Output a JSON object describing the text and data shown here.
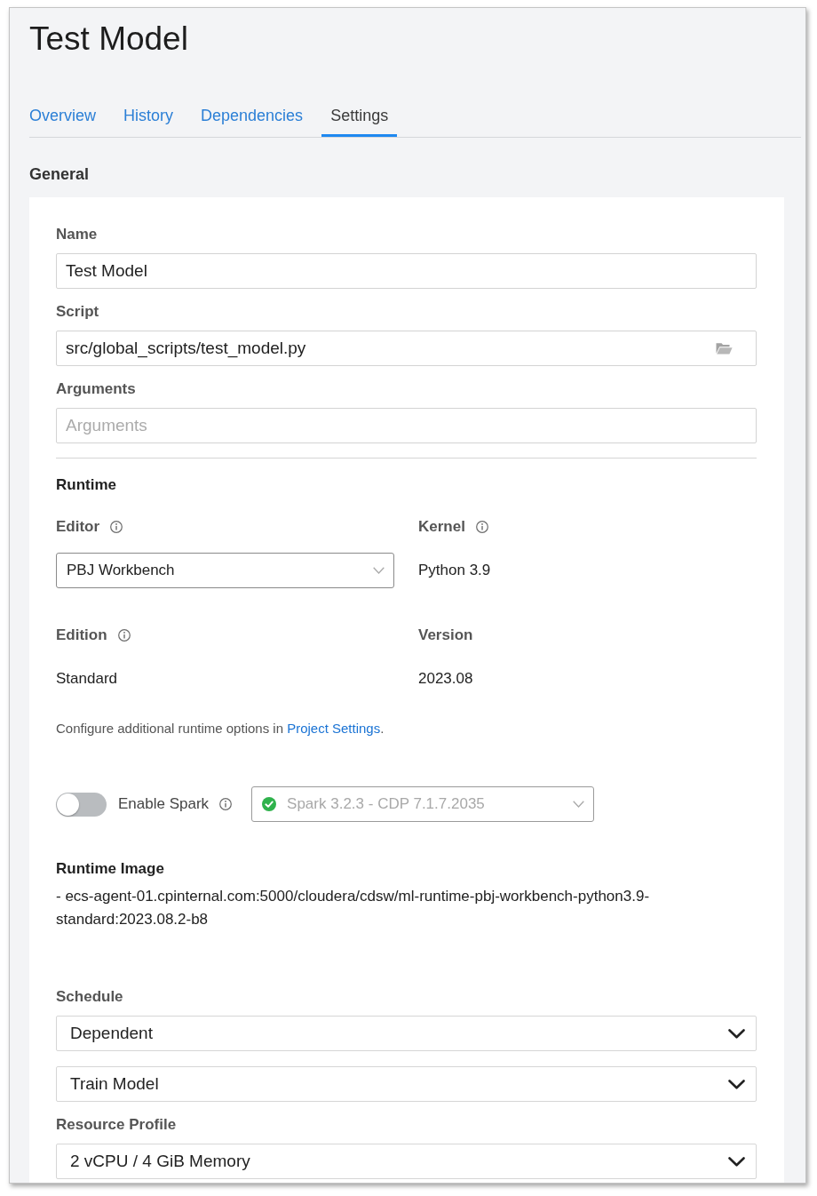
{
  "page": {
    "title": "Test Model"
  },
  "tabs": [
    {
      "label": "Overview",
      "selected": false
    },
    {
      "label": "History",
      "selected": false
    },
    {
      "label": "Dependencies",
      "selected": false
    },
    {
      "label": "Settings",
      "selected": true
    }
  ],
  "general": {
    "heading": "General",
    "fields": [
      {
        "kind": "text",
        "label": "Name",
        "value": "Test Model"
      },
      {
        "kind": "file",
        "label": "Script",
        "value": "src/global_scripts/test_model.py"
      },
      {
        "kind": "text",
        "label": "Arguments",
        "placeholder": "Arguments"
      }
    ]
  },
  "runtime": {
    "heading": "Runtime",
    "fields": [
      {
        "kind": "select",
        "label": "Editor",
        "info": true,
        "value": "PBJ Workbench"
      },
      {
        "kind": "static",
        "label": "Kernel",
        "info": true,
        "value": "Python 3.9"
      },
      {
        "kind": "static",
        "label": "Edition",
        "info": true,
        "value": "Standard"
      },
      {
        "kind": "static",
        "label": "Version",
        "info": false,
        "value": "2023.08"
      }
    ],
    "note": {
      "text": "Configure additional runtime options in",
      "link": "Project Settings",
      "after": "."
    },
    "spark": {
      "label": "Enable Spark",
      "on": false,
      "info": true,
      "select": {
        "value": "Spark 3.2.3 - CDP 7.1.7.2035",
        "disabled": true
      }
    }
  },
  "runtime_image": {
    "heading": "Runtime Image",
    "value": "- ecs-agent-01.cpinternal.com:5000/cloudera/cdsw/ml-runtime-pbj-workbench-python3.9-standard:2023.08.2-b8"
  },
  "schedule": {
    "label": "Schedule",
    "selects": [
      {
        "value": "Dependent"
      },
      {
        "value": "Train Model"
      }
    ]
  },
  "resource_profile": {
    "label": "Resource Profile",
    "value": "2 vCPU / 4 GiB Memory"
  }
}
